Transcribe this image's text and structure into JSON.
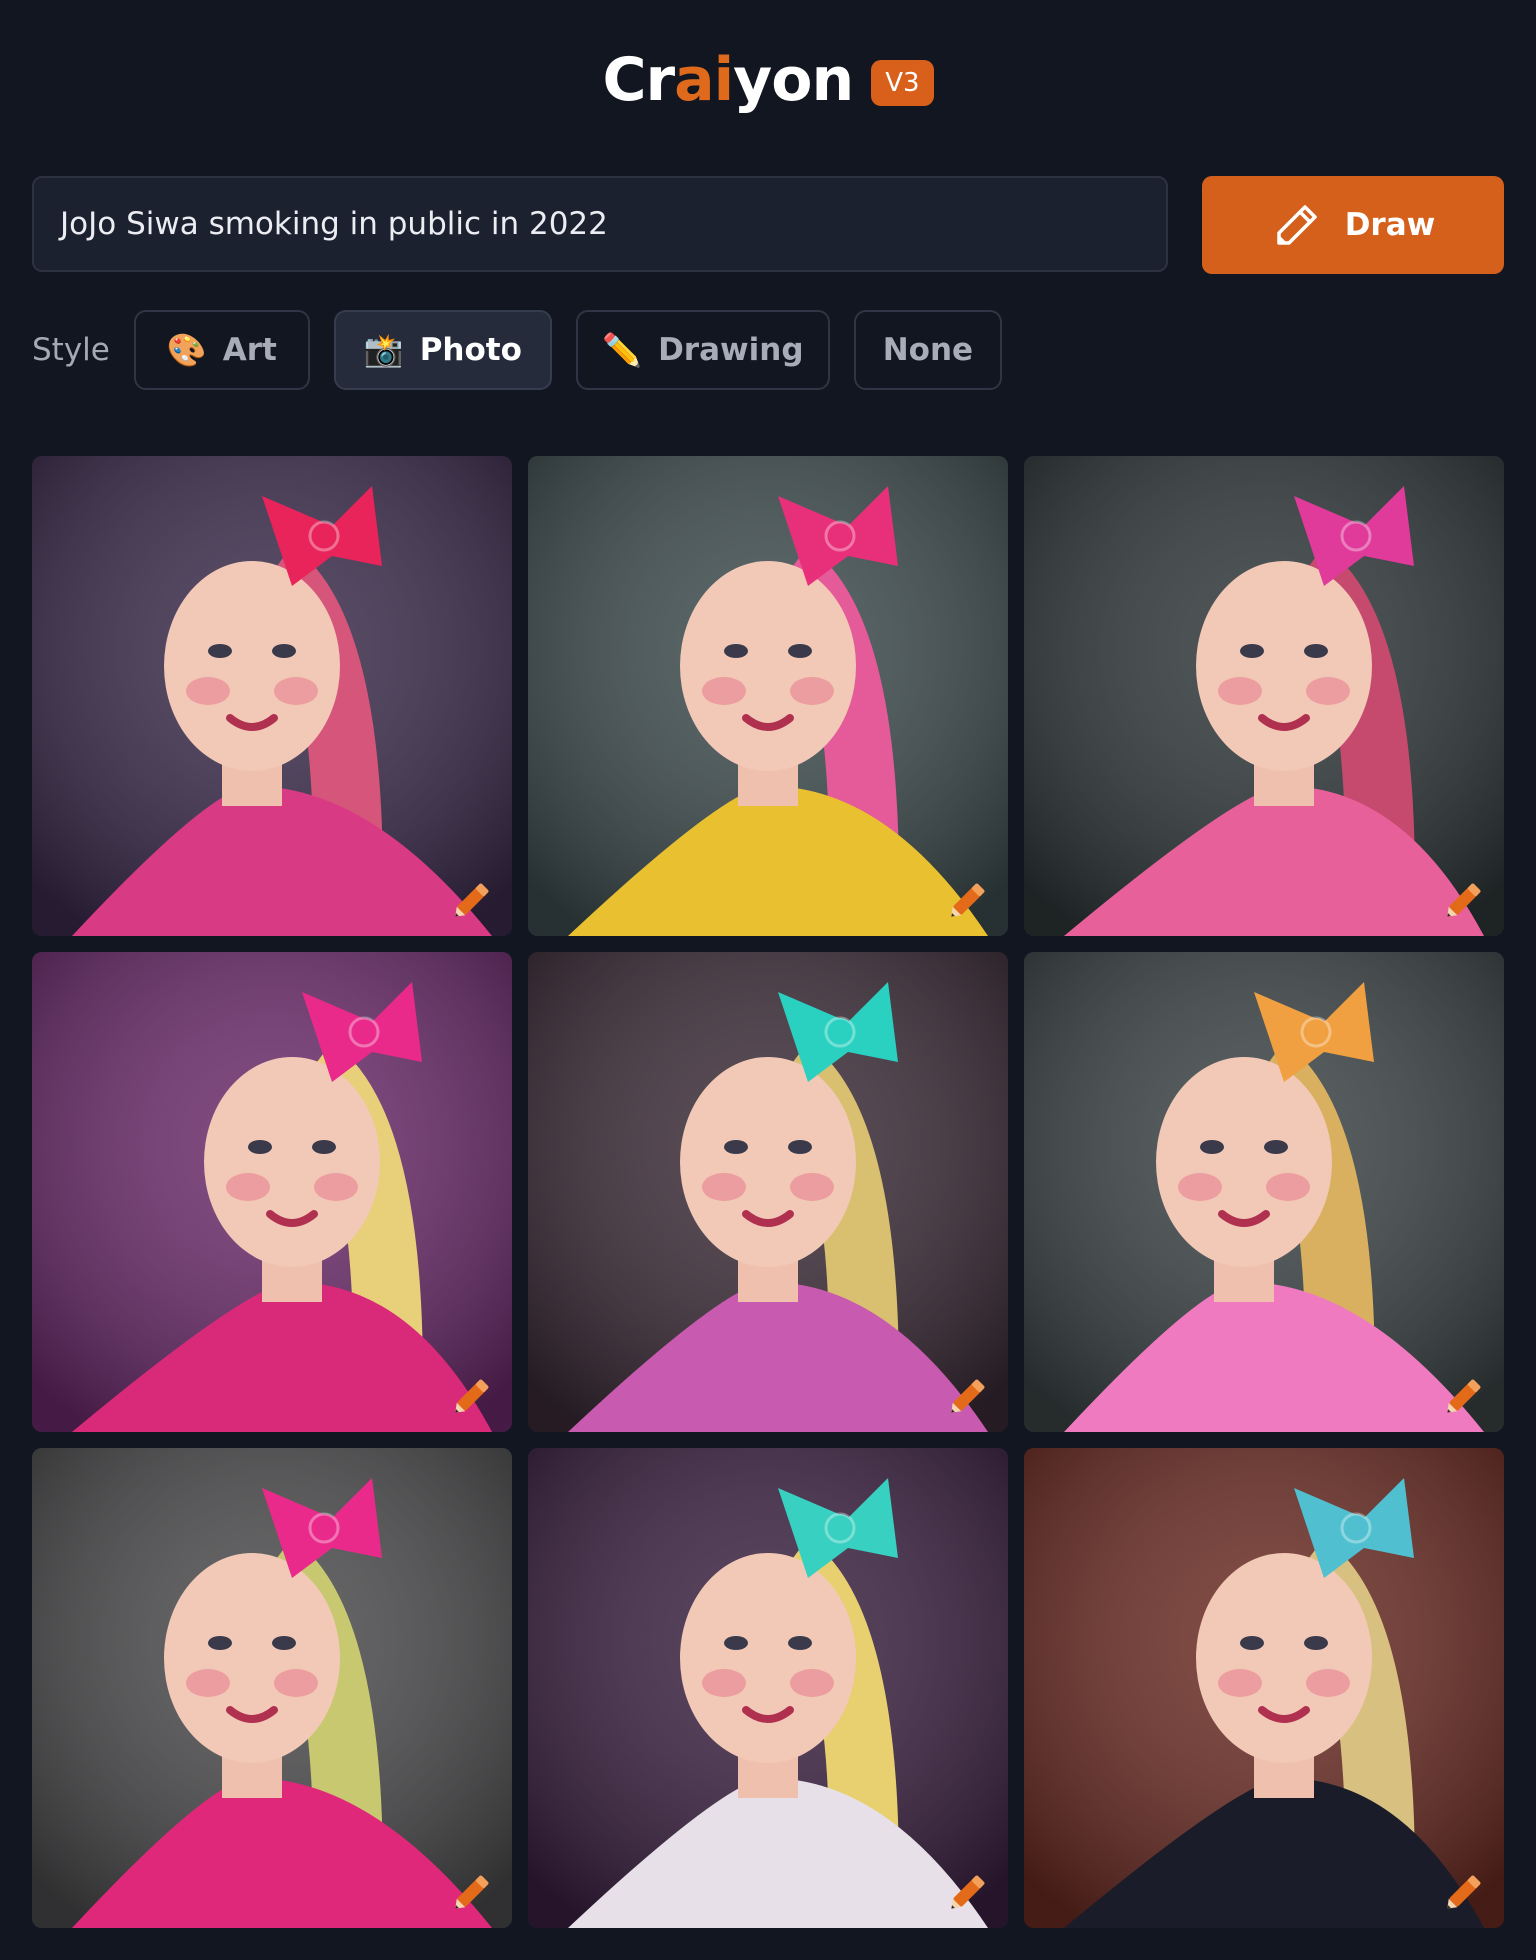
{
  "header": {
    "logo_parts": [
      "Cr",
      "ai",
      "yon"
    ],
    "version": "V3"
  },
  "prompt": {
    "value": "JoJo Siwa smoking in public in 2022",
    "draw_label": "Draw",
    "draw_icon": "pencil-icon"
  },
  "style": {
    "label": "Style",
    "options": [
      {
        "label": "Art",
        "icon": "palette-icon",
        "emoji": "🎨",
        "active": false
      },
      {
        "label": "Photo",
        "icon": "camera-flash-icon",
        "emoji": "📸",
        "active": true
      },
      {
        "label": "Drawing",
        "icon": "pencil-icon",
        "emoji": "✏️",
        "active": false
      },
      {
        "label": "None",
        "icon": "",
        "emoji": "",
        "active": false
      }
    ]
  },
  "colors": {
    "background": "#121620",
    "accent": "#d5601c",
    "input_bg": "#1c2130"
  },
  "images": [
    {
      "bg": "#3a2a4a",
      "hair": "#d6557a",
      "bow": "#e8245a",
      "shirt": "#d93a84"
    },
    {
      "bg": "#3c4a4c",
      "hair": "#e55a98",
      "bow": "#e8307a",
      "shirt": "#e8c030"
    },
    {
      "bg": "#2e3638",
      "hair": "#c64a6e",
      "bow": "#e03a9a",
      "shirt": "#e8609a"
    },
    {
      "bg": "#6a2a6a",
      "hair": "#e8d07a",
      "bow": "#ea2a8a",
      "shirt": "#d92a7a"
    },
    {
      "bg": "#3a2a36",
      "hair": "#d8c070",
      "bow": "#2ad0c0",
      "shirt": "#c85ab0"
    },
    {
      "bg": "#3a4244",
      "hair": "#d8b060",
      "bow": "#f0a040",
      "shirt": "#f07ac0"
    },
    {
      "bg": "#4a4a4c",
      "hair": "#c8c870",
      "bow": "#ea2a8a",
      "shirt": "#e0287a"
    },
    {
      "bg": "#3a2040",
      "hair": "#e8d070",
      "bow": "#38d0c0",
      "shirt": "#e8e0e8"
    },
    {
      "bg": "#6a2a22",
      "hair": "#d8c080",
      "bow": "#50c0d0",
      "shirt": "#1a1c2a"
    }
  ]
}
